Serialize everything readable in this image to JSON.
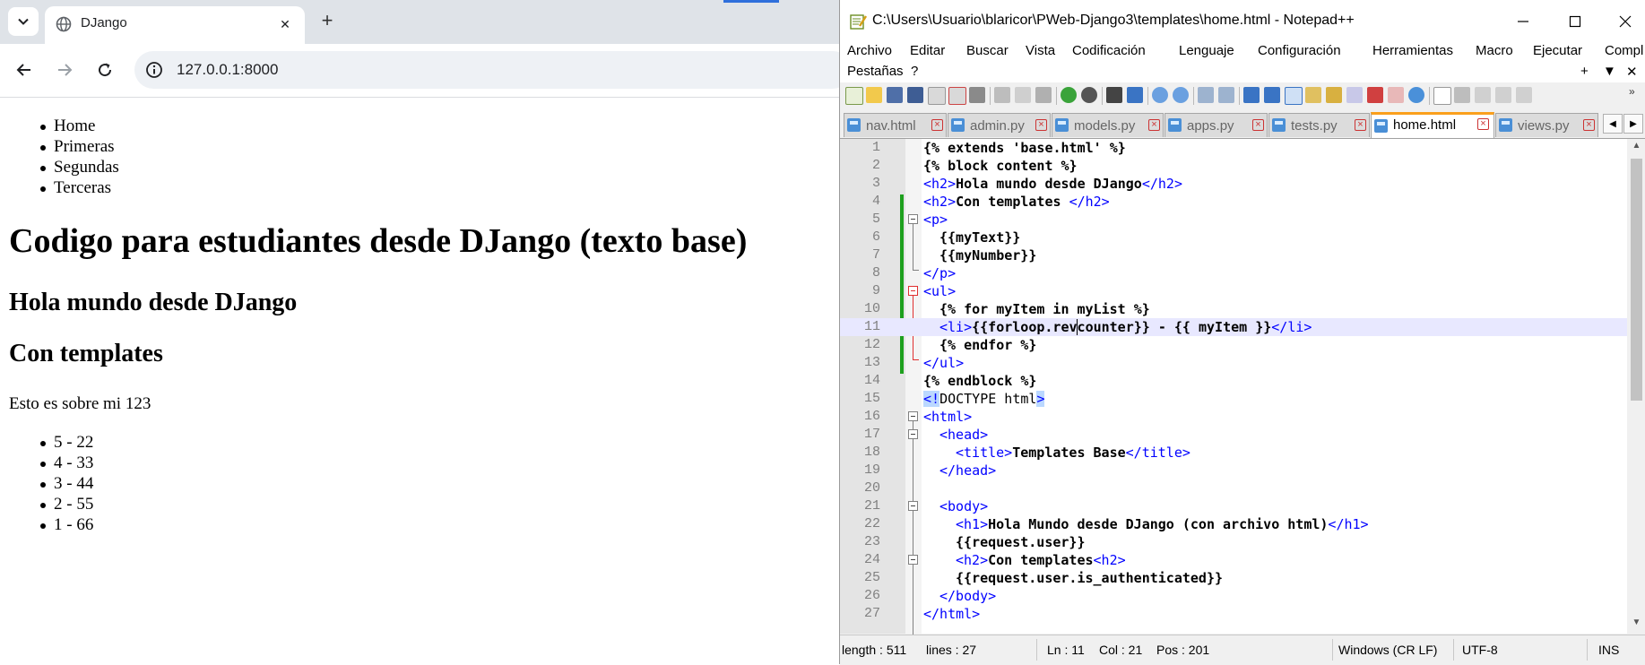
{
  "browser": {
    "tab_title": "DJango",
    "url": "127.0.0.1:8000",
    "page": {
      "nav_items": [
        "Home",
        "Primeras",
        "Segundas",
        "Terceras"
      ],
      "heading1": "Codigo para estudiantes desde DJango (texto base)",
      "heading2a": "Hola mundo desde DJango",
      "heading2b": "Con templates",
      "paragraph": "Esto es sobre mi 123",
      "list_items": [
        "5 - 22",
        "4 - 33",
        "3 - 44",
        "2 - 55",
        "1 - 66"
      ]
    }
  },
  "notepad": {
    "title": "C:\\Users\\Usuario\\blaricor\\PWeb-Django3\\templates\\home.html - Notepad++",
    "menu": [
      "Archivo",
      "Editar",
      "Buscar",
      "Vista",
      "Codificación",
      "Lenguaje",
      "Configuración",
      "Herramientas",
      "Macro",
      "Ejecutar",
      "Complementos",
      "Pestañas",
      "?"
    ],
    "menu_controls": [
      "+",
      "▼",
      "✕"
    ],
    "tabs": [
      "nav.html",
      "admin.py",
      "models.py",
      "apps.py",
      "tests.py",
      "home.html",
      "views.py"
    ],
    "active_tab": "home.html",
    "line_numbers": [
      "1",
      "2",
      "3",
      "4",
      "5",
      "6",
      "7",
      "8",
      "9",
      "10",
      "11",
      "12",
      "13",
      "14",
      "15",
      "16",
      "17",
      "18",
      "19",
      "20",
      "21",
      "22",
      "23",
      "24",
      "25",
      "26",
      "27"
    ],
    "status": {
      "length": "length : 511",
      "lines": "lines : 27",
      "ln": "Ln : 11",
      "col": "Col : 21",
      "pos": "Pos : 201",
      "eol": "Windows (CR LF)",
      "encoding": "UTF-8",
      "mode": "INS"
    },
    "code": {
      "l1": "{% extends 'base.html' %}",
      "l2": "{% block content %}",
      "l3_open": "<h2>",
      "l3_text": "Hola mundo desde DJango",
      "l3_close": "</h2>",
      "l4_open": "<h2>",
      "l4_text": "Con templates ",
      "l4_close": "</h2>",
      "l5": "<p>",
      "l6": "{{myText}}",
      "l7": "{{myNumber}}",
      "l8": "</p>",
      "l9": "<ul>",
      "l10": "{% for myItem in myList %}",
      "l11_open": "<li>",
      "l11_a": "{{forloop.revc",
      "l11_b": "ounter}} - {{ myItem }}",
      "l11_close": "</li>",
      "l12": "{% endfor %}",
      "l13": "</ul>",
      "l14": "{% endblock %}",
      "l15_a": "<!",
      "l15_b": "DOCTYPE html",
      "l15_c": ">",
      "l16": "<html>",
      "l17": "<head>",
      "l18_open": "<title>",
      "l18_text": "Templates Base",
      "l18_close": "</title>",
      "l19": "</head>",
      "l21": "<body>",
      "l22_open": "<h1>",
      "l22_text": "Hola Mundo desde DJango (con archivo html)",
      "l22_close": "</h1>",
      "l23": "{{request.user}}",
      "l24_open": "<h2>",
      "l24_text": "Con templates",
      "l24_close": "<h2>",
      "l25": "{{request.user.is_authenticated}}",
      "l26": "</body>",
      "l27": "</html>"
    }
  },
  "colors": {
    "tag": "#0000ff",
    "active_tab_accent": "#fa9f1c",
    "change_marker": "#1ea01e",
    "current_line": "#e8e8ff"
  }
}
